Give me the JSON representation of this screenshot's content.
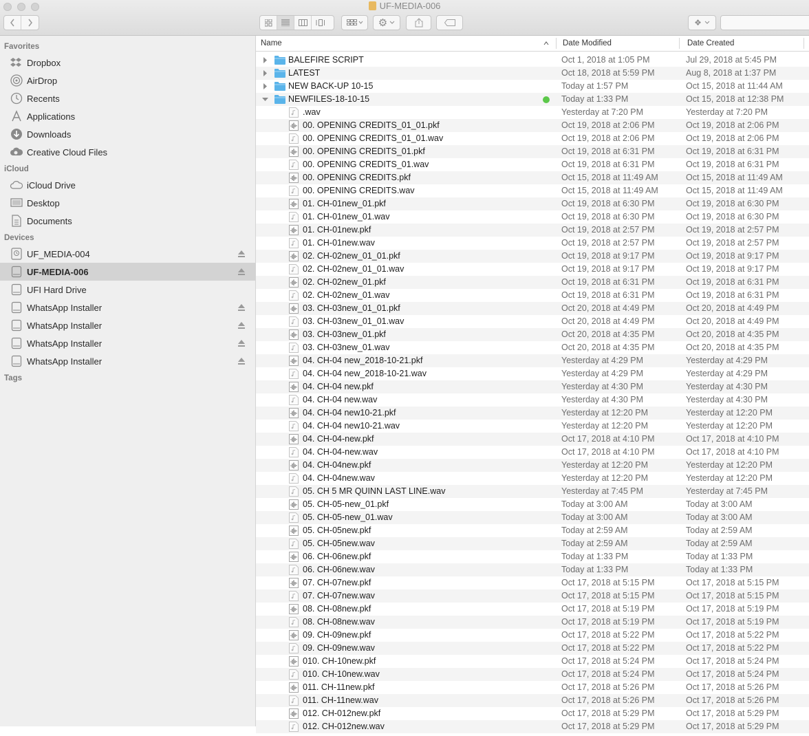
{
  "window": {
    "title": "UF-MEDIA-006"
  },
  "sidebar": {
    "sections": [
      {
        "heading": "Favorites",
        "items": [
          {
            "label": "Dropbox",
            "icon": "dropbox-icon"
          },
          {
            "label": "AirDrop",
            "icon": "airdrop-icon"
          },
          {
            "label": "Recents",
            "icon": "clock-icon"
          },
          {
            "label": "Applications",
            "icon": "applications-icon"
          },
          {
            "label": "Downloads",
            "icon": "download-icon"
          },
          {
            "label": "Creative Cloud Files",
            "icon": "creative-cloud-icon"
          }
        ]
      },
      {
        "heading": "iCloud",
        "items": [
          {
            "label": "iCloud Drive",
            "icon": "cloud-icon"
          },
          {
            "label": "Desktop",
            "icon": "desktop-icon"
          },
          {
            "label": "Documents",
            "icon": "document-icon"
          }
        ]
      },
      {
        "heading": "Devices",
        "items": [
          {
            "label": "UF_MEDIA-004",
            "icon": "timemachine-drive-icon",
            "eject": true
          },
          {
            "label": "UF-MEDIA-006",
            "icon": "drive-icon",
            "eject": true,
            "selected": true
          },
          {
            "label": "UFI Hard Drive",
            "icon": "drive-icon",
            "eject": false
          },
          {
            "label": "WhatsApp Installer",
            "icon": "drive-icon",
            "eject": true
          },
          {
            "label": "WhatsApp Installer",
            "icon": "drive-icon",
            "eject": true
          },
          {
            "label": "WhatsApp Installer",
            "icon": "drive-icon",
            "eject": true
          },
          {
            "label": "WhatsApp Installer",
            "icon": "drive-icon",
            "eject": true
          }
        ]
      },
      {
        "heading": "Tags",
        "items": []
      }
    ]
  },
  "columns": {
    "name": "Name",
    "modified": "Date Modified",
    "created": "Date Created",
    "sort_indicator": "^"
  },
  "rows": [
    {
      "name": "BALEFIRE SCRIPT",
      "type": "folder",
      "disclosure": "closed",
      "modified": "Oct 1, 2018 at 1:05 PM",
      "created": "Jul 29, 2018 at 5:45 PM"
    },
    {
      "name": "LATEST",
      "type": "folder",
      "disclosure": "closed",
      "modified": "Oct 18, 2018 at 5:59 PM",
      "created": "Aug 8, 2018 at 1:37 PM"
    },
    {
      "name": "NEW BACK-UP 10-15",
      "type": "folder",
      "disclosure": "closed",
      "modified": "Today at 1:57 PM",
      "created": "Oct 15, 2018 at 11:44 AM"
    },
    {
      "name": "NEWFILES-18-10-15",
      "type": "folder",
      "disclosure": "open",
      "tag": "green",
      "modified": "Today at 1:33 PM",
      "created": "Oct 15, 2018 at 12:38 PM"
    },
    {
      "name": ".wav",
      "type": "wav",
      "modified": "Yesterday at 7:20 PM",
      "created": "Yesterday at 7:20 PM"
    },
    {
      "name": "00. OPENING CREDITS_01_01.pkf",
      "type": "pkf",
      "modified": "Oct 19, 2018 at 2:06 PM",
      "created": "Oct 19, 2018 at 2:06 PM"
    },
    {
      "name": "00. OPENING CREDITS_01_01.wav",
      "type": "wav",
      "modified": "Oct 19, 2018 at 2:06 PM",
      "created": "Oct 19, 2018 at 2:06 PM"
    },
    {
      "name": "00. OPENING CREDITS_01.pkf",
      "type": "pkf",
      "modified": "Oct 19, 2018 at 6:31 PM",
      "created": "Oct 19, 2018 at 6:31 PM"
    },
    {
      "name": "00. OPENING CREDITS_01.wav",
      "type": "wav",
      "modified": "Oct 19, 2018 at 6:31 PM",
      "created": "Oct 19, 2018 at 6:31 PM"
    },
    {
      "name": "00. OPENING CREDITS.pkf",
      "type": "pkf",
      "modified": "Oct 15, 2018 at 11:49 AM",
      "created": "Oct 15, 2018 at 11:49 AM"
    },
    {
      "name": "00. OPENING CREDITS.wav",
      "type": "wav",
      "modified": "Oct 15, 2018 at 11:49 AM",
      "created": "Oct 15, 2018 at 11:49 AM"
    },
    {
      "name": "01.  CH-01new_01.pkf",
      "type": "pkf",
      "modified": "Oct 19, 2018 at 6:30 PM",
      "created": "Oct 19, 2018 at 6:30 PM"
    },
    {
      "name": "01.  CH-01new_01.wav",
      "type": "wav",
      "modified": "Oct 19, 2018 at 6:30 PM",
      "created": "Oct 19, 2018 at 6:30 PM"
    },
    {
      "name": "01.  CH-01new.pkf",
      "type": "pkf",
      "modified": "Oct 19, 2018 at 2:57 PM",
      "created": "Oct 19, 2018 at 2:57 PM"
    },
    {
      "name": "01.  CH-01new.wav",
      "type": "wav",
      "modified": "Oct 19, 2018 at 2:57 PM",
      "created": "Oct 19, 2018 at 2:57 PM"
    },
    {
      "name": "02. CH-02new_01_01.pkf",
      "type": "pkf",
      "modified": "Oct 19, 2018 at 9:17 PM",
      "created": "Oct 19, 2018 at 9:17 PM"
    },
    {
      "name": "02. CH-02new_01_01.wav",
      "type": "wav",
      "modified": "Oct 19, 2018 at 9:17 PM",
      "created": "Oct 19, 2018 at 9:17 PM"
    },
    {
      "name": "02. CH-02new_01.pkf",
      "type": "pkf",
      "modified": "Oct 19, 2018 at 6:31 PM",
      "created": "Oct 19, 2018 at 6:31 PM"
    },
    {
      "name": "02. CH-02new_01.wav",
      "type": "wav",
      "modified": "Oct 19, 2018 at 6:31 PM",
      "created": "Oct 19, 2018 at 6:31 PM"
    },
    {
      "name": "03. CH-03new_01_01.pkf",
      "type": "pkf",
      "modified": "Oct 20, 2018 at 4:49 PM",
      "created": "Oct 20, 2018 at 4:49 PM"
    },
    {
      "name": "03. CH-03new_01_01.wav",
      "type": "wav",
      "modified": "Oct 20, 2018 at 4:49 PM",
      "created": "Oct 20, 2018 at 4:49 PM"
    },
    {
      "name": "03. CH-03new_01.pkf",
      "type": "pkf",
      "modified": "Oct 20, 2018 at 4:35 PM",
      "created": "Oct 20, 2018 at 4:35 PM"
    },
    {
      "name": "03. CH-03new_01.wav",
      "type": "wav",
      "modified": "Oct 20, 2018 at 4:35 PM",
      "created": "Oct 20, 2018 at 4:35 PM"
    },
    {
      "name": "04. CH-04 new_2018-10-21.pkf",
      "type": "pkf",
      "modified": "Yesterday at 4:29 PM",
      "created": "Yesterday at 4:29 PM"
    },
    {
      "name": "04. CH-04 new_2018-10-21.wav",
      "type": "wav",
      "modified": "Yesterday at 4:29 PM",
      "created": "Yesterday at 4:29 PM"
    },
    {
      "name": "04. CH-04 new.pkf",
      "type": "pkf",
      "modified": "Yesterday at 4:30 PM",
      "created": "Yesterday at 4:30 PM"
    },
    {
      "name": "04. CH-04 new.wav",
      "type": "wav",
      "modified": "Yesterday at 4:30 PM",
      "created": "Yesterday at 4:30 PM"
    },
    {
      "name": "04. CH-04 new10-21.pkf",
      "type": "pkf",
      "modified": "Yesterday at 12:20 PM",
      "created": "Yesterday at 12:20 PM"
    },
    {
      "name": "04. CH-04 new10-21.wav",
      "type": "wav",
      "modified": "Yesterday at 12:20 PM",
      "created": "Yesterday at 12:20 PM"
    },
    {
      "name": "04. CH-04-new.pkf",
      "type": "pkf",
      "modified": "Oct 17, 2018 at 4:10 PM",
      "created": "Oct 17, 2018 at 4:10 PM"
    },
    {
      "name": "04. CH-04-new.wav",
      "type": "wav",
      "modified": "Oct 17, 2018 at 4:10 PM",
      "created": "Oct 17, 2018 at 4:10 PM"
    },
    {
      "name": "04. CH-04new.pkf",
      "type": "pkf",
      "modified": "Yesterday at 12:20 PM",
      "created": "Yesterday at 12:20 PM"
    },
    {
      "name": "04. CH-04new.wav",
      "type": "wav",
      "modified": "Yesterday at 12:20 PM",
      "created": "Yesterday at 12:20 PM"
    },
    {
      "name": "05. CH 5 MR QUINN LAST LINE.wav",
      "type": "wav",
      "modified": "Yesterday at 7:45 PM",
      "created": "Yesterday at 7:45 PM"
    },
    {
      "name": "05. CH-05-new_01.pkf",
      "type": "pkf",
      "modified": "Today at 3:00 AM",
      "created": "Today at 3:00 AM"
    },
    {
      "name": "05. CH-05-new_01.wav",
      "type": "wav",
      "modified": "Today at 3:00 AM",
      "created": "Today at 3:00 AM"
    },
    {
      "name": "05. CH-05new.pkf",
      "type": "pkf",
      "modified": "Today at 2:59 AM",
      "created": "Today at 2:59 AM"
    },
    {
      "name": "05. CH-05new.wav",
      "type": "wav",
      "modified": "Today at 2:59 AM",
      "created": "Today at 2:59 AM"
    },
    {
      "name": "06. CH-06new.pkf",
      "type": "pkf",
      "modified": "Today at 1:33 PM",
      "created": "Today at 1:33 PM"
    },
    {
      "name": "06. CH-06new.wav",
      "type": "wav",
      "modified": "Today at 1:33 PM",
      "created": "Today at 1:33 PM"
    },
    {
      "name": "07. CH-07new.pkf",
      "type": "pkf",
      "modified": "Oct 17, 2018 at 5:15 PM",
      "created": "Oct 17, 2018 at 5:15 PM"
    },
    {
      "name": "07. CH-07new.wav",
      "type": "wav",
      "modified": "Oct 17, 2018 at 5:15 PM",
      "created": "Oct 17, 2018 at 5:15 PM"
    },
    {
      "name": "08. CH-08new.pkf",
      "type": "pkf",
      "modified": "Oct 17, 2018 at 5:19 PM",
      "created": "Oct 17, 2018 at 5:19 PM"
    },
    {
      "name": "08. CH-08new.wav",
      "type": "wav",
      "modified": "Oct 17, 2018 at 5:19 PM",
      "created": "Oct 17, 2018 at 5:19 PM"
    },
    {
      "name": "09. CH-09new.pkf",
      "type": "pkf",
      "modified": "Oct 17, 2018 at 5:22 PM",
      "created": "Oct 17, 2018 at 5:22 PM"
    },
    {
      "name": "09. CH-09new.wav",
      "type": "wav",
      "modified": "Oct 17, 2018 at 5:22 PM",
      "created": "Oct 17, 2018 at 5:22 PM"
    },
    {
      "name": "010. CH-10new.pkf",
      "type": "pkf",
      "modified": "Oct 17, 2018 at 5:24 PM",
      "created": "Oct 17, 2018 at 5:24 PM"
    },
    {
      "name": "010. CH-10new.wav",
      "type": "wav",
      "modified": "Oct 17, 2018 at 5:24 PM",
      "created": "Oct 17, 2018 at 5:24 PM"
    },
    {
      "name": "011. CH-11new.pkf",
      "type": "pkf",
      "modified": "Oct 17, 2018 at 5:26 PM",
      "created": "Oct 17, 2018 at 5:26 PM"
    },
    {
      "name": "011. CH-11new.wav",
      "type": "wav",
      "modified": "Oct 17, 2018 at 5:26 PM",
      "created": "Oct 17, 2018 at 5:26 PM"
    },
    {
      "name": "012. CH-012new.pkf",
      "type": "pkf",
      "modified": "Oct 17, 2018 at 5:29 PM",
      "created": "Oct 17, 2018 at 5:29 PM"
    },
    {
      "name": "012. CH-012new.wav",
      "type": "wav",
      "modified": "Oct 17, 2018 at 5:29 PM",
      "created": "Oct 17, 2018 at 5:29 PM"
    }
  ],
  "colors": {
    "folder": "#5ab4ea",
    "tag_green": "#5cc84a",
    "selected": "#d3d3d3",
    "alt_row": "#f4f4f4"
  }
}
